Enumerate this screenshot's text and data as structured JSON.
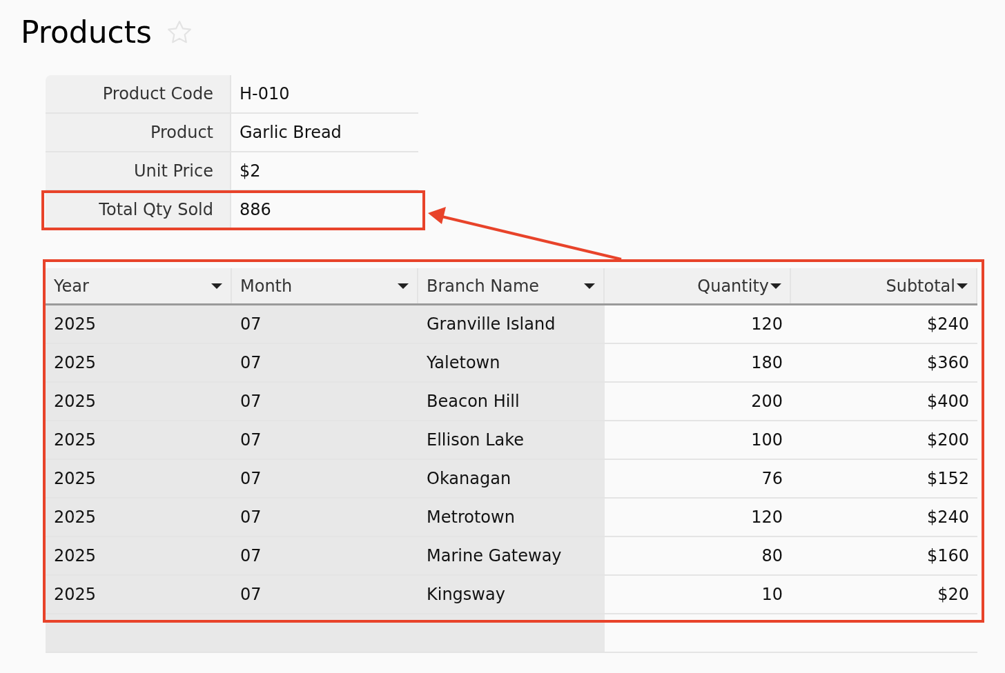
{
  "page": {
    "title": "Products",
    "favorite": false
  },
  "fields": [
    {
      "label": "Product Code",
      "value": "H-010",
      "highlighted": false
    },
    {
      "label": "Product",
      "value": "Garlic Bread",
      "highlighted": false
    },
    {
      "label": "Unit Price",
      "value": "$2",
      "highlighted": false
    },
    {
      "label": "Total Qty Sold",
      "value": "886",
      "highlighted": true
    }
  ],
  "table": {
    "highlighted": true,
    "columns": [
      {
        "label": "Year",
        "kind": "text"
      },
      {
        "label": "Month",
        "kind": "text"
      },
      {
        "label": "Branch Name",
        "kind": "text"
      },
      {
        "label": "Quantity",
        "kind": "number"
      },
      {
        "label": "Subtotal",
        "kind": "number"
      }
    ],
    "rows": [
      [
        "2025",
        "07",
        "Granville Island",
        "120",
        "$240"
      ],
      [
        "2025",
        "07",
        "Yaletown",
        "180",
        "$360"
      ],
      [
        "2025",
        "07",
        "Beacon Hill",
        "200",
        "$400"
      ],
      [
        "2025",
        "07",
        "Ellison Lake",
        "100",
        "$200"
      ],
      [
        "2025",
        "07",
        "Okanagan",
        "76",
        "$152"
      ],
      [
        "2025",
        "07",
        "Metrotown",
        "120",
        "$240"
      ],
      [
        "2025",
        "07",
        "Marine Gateway",
        "80",
        "$160"
      ],
      [
        "2025",
        "07",
        "Kingsway",
        "10",
        "$20"
      ]
    ]
  }
}
